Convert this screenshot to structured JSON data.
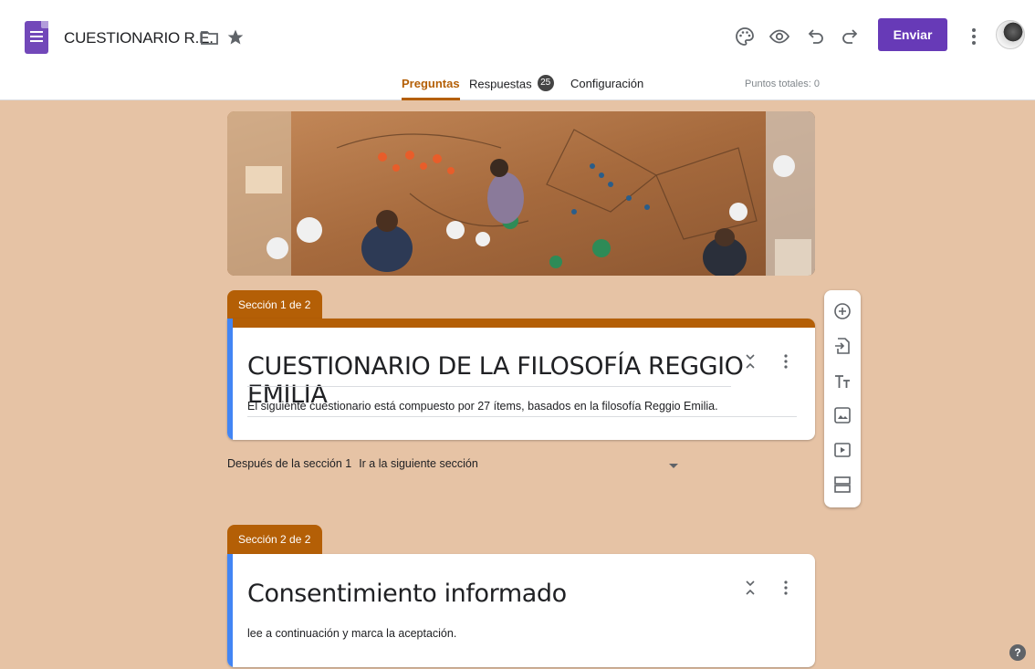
{
  "header": {
    "doc_title": "CUESTIONARIO R.E.",
    "send_label": "Enviar",
    "toolbar_icons": [
      "palette-icon",
      "eye-icon",
      "undo-icon",
      "redo-icon"
    ]
  },
  "tabs": [
    {
      "label": "Preguntas",
      "active": true
    },
    {
      "label": "Respuestas",
      "badge": "25"
    },
    {
      "label": "Configuración"
    }
  ],
  "points_total": "Puntos totales: 0",
  "sections": [
    {
      "label": "Sección 1 de 2",
      "title": "CUESTIONARIO DE LA FILOSOFÍA REGGIO EMILIA",
      "description": "El siguiente cuestionario está compuesto por 27 ítems, basados en la filosofía Reggio Emilia."
    },
    {
      "label": "Sección 2 de 2",
      "title": "Consentimiento informado",
      "description": "lee a continuación y marca la aceptación."
    }
  ],
  "after_section": {
    "label": "Después de la sección 1",
    "value": "Ir a la siguiente sección"
  },
  "float_toolbar": [
    "add-question-icon",
    "import-questions-icon",
    "add-title-icon",
    "add-image-icon",
    "add-video-icon",
    "add-section-icon"
  ],
  "colors": {
    "accent": "#b45f06",
    "page_background": "#e6c3a5",
    "send_button": "#673ab7",
    "section_bar": "#4285f4"
  }
}
